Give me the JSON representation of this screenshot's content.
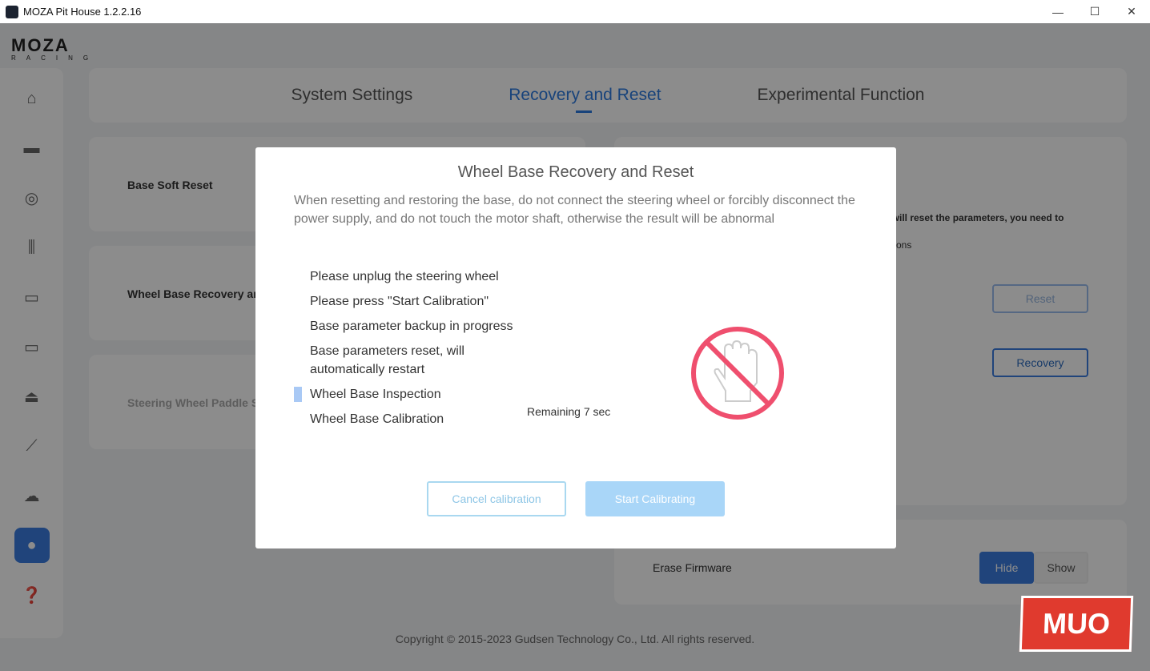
{
  "window": {
    "title": "MOZA Pit House 1.2.2.16",
    "minimize": "—",
    "maximize": "☐",
    "close": "✕"
  },
  "logo": {
    "main": "MOZA",
    "sub": "RACING"
  },
  "sidebar": {
    "items": [
      {
        "icon": "home-icon",
        "glyph": "⌂"
      },
      {
        "icon": "wheelbase-icon",
        "glyph": "▬"
      },
      {
        "icon": "steering-wheel-icon",
        "glyph": "◎"
      },
      {
        "icon": "pedals-icon",
        "glyph": "⫼"
      },
      {
        "icon": "dashboard-icon",
        "glyph": "▭"
      },
      {
        "icon": "shifter-bar-icon",
        "glyph": "▭"
      },
      {
        "icon": "joystick-icon",
        "glyph": "⏏"
      },
      {
        "icon": "handbrake-icon",
        "glyph": "⟋"
      },
      {
        "icon": "cloud-upload-icon",
        "glyph": "☁"
      },
      {
        "icon": "user-icon",
        "glyph": "●",
        "active": true
      },
      {
        "icon": "faq-icon",
        "glyph": "❓"
      }
    ]
  },
  "tabs": [
    {
      "label": "System Settings"
    },
    {
      "label": "Recovery and Reset",
      "active": true
    },
    {
      "label": "Experimental Function"
    }
  ],
  "background": {
    "base_soft_reset": "Base Soft Reset",
    "wheel_base_recovery": "Wheel Base Recovery and Reset",
    "paddle": "Steering Wheel Paddle Settings",
    "desc1": "l will reset the parameters, you need to",
    "desc2": "ctions",
    "reset": "Reset",
    "recovery": "Recovery",
    "erase_firmware": "Erase Firmware",
    "hide": "Hide",
    "show": "Show"
  },
  "modal": {
    "title": "Wheel Base Recovery and Reset",
    "warning": "When resetting and restoring the base, do not connect the steering wheel or forcibly disconnect the power supply, and do not touch the motor shaft, otherwise the result will be abnormal",
    "steps": [
      "Please unplug the steering wheel",
      "Please press \"Start Calibration\"",
      "Base parameter backup in progress",
      "Base parameters reset, will automatically restart",
      "Wheel Base Inspection",
      "Wheel Base Calibration"
    ],
    "current_step": 4,
    "remaining": "Remaining 7 sec",
    "cancel": "Cancel calibration",
    "start": "Start Calibrating"
  },
  "footer": {
    "copyright": "Copyright © 2015-2023 Gudsen Technology Co., Ltd. All rights reserved."
  },
  "watermark": "MUO",
  "colors": {
    "accent": "#2d7be0",
    "stop": "#ef4f6e"
  }
}
